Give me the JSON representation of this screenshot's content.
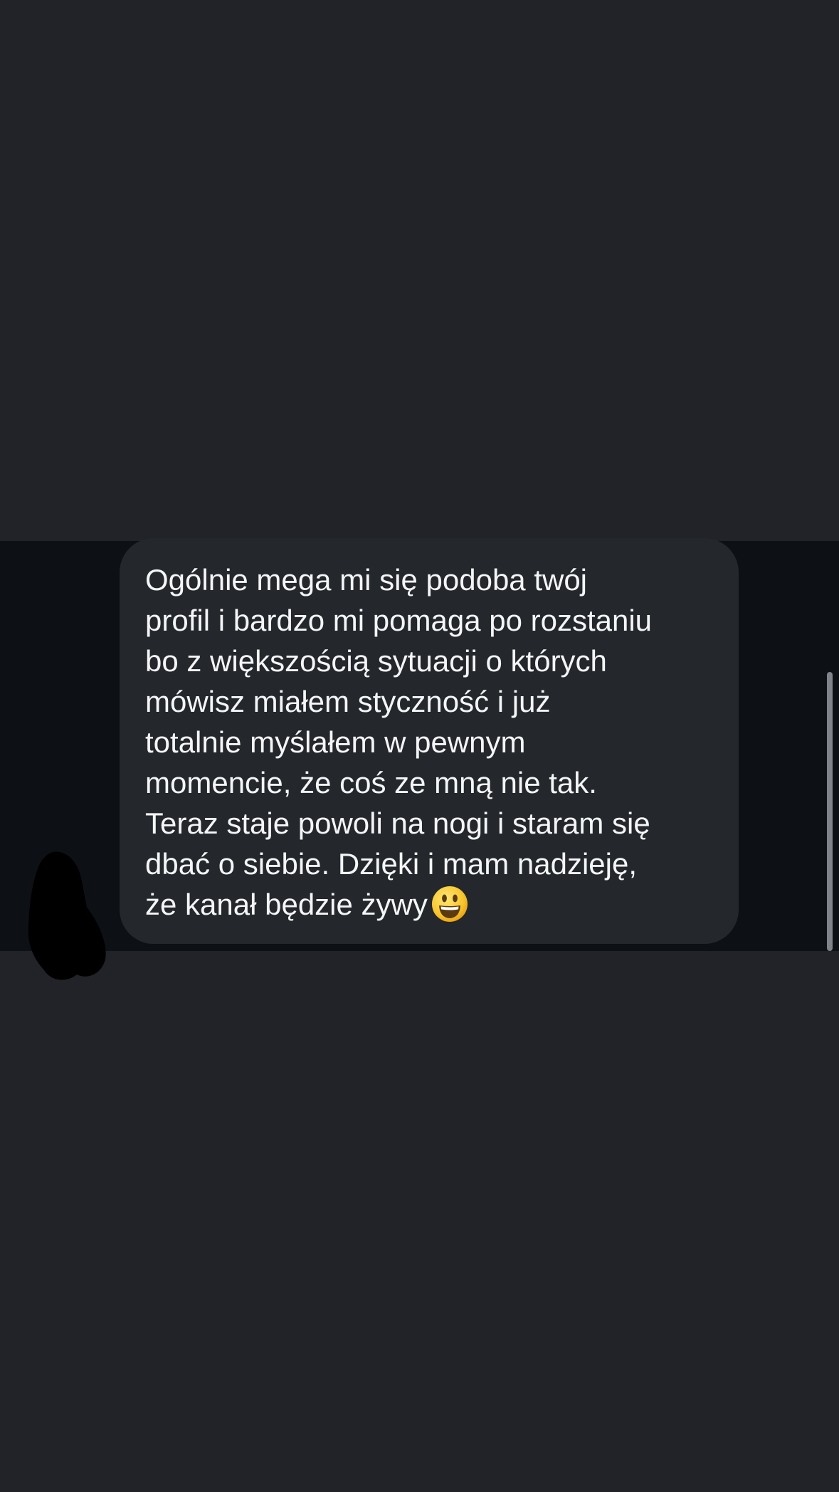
{
  "conversation": {
    "message": {
      "lines": [
        "Ogólnie mega mi się podoba twój",
        "profil i bardzo mi pomaga po rozstaniu",
        "bo z większością sytuacji o których",
        "mówisz miałem styczność i już",
        "totalnie myślałem w pewnym",
        "momencie, że coś ze mną nie tak.",
        "Teraz staje powoli na nogi i staram się",
        "dbać o siebie. Dzięki i mam nadzieję,",
        "że kanał będzie żywy"
      ],
      "emoji": "smiling-face-with-open-mouth"
    }
  },
  "colors": {
    "background": "#212328",
    "chat_strip": "#0d1014",
    "bubble": "#24272c",
    "text": "#f4f5f6",
    "scrollbar": "#80848a"
  }
}
